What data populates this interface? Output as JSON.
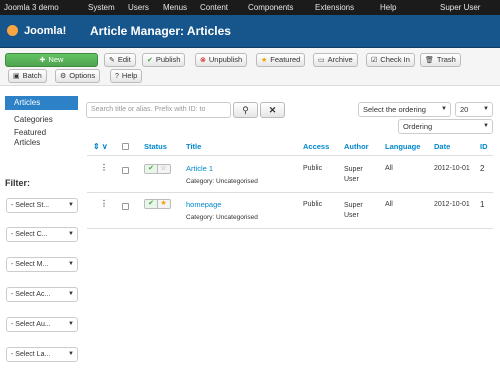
{
  "topbar": {
    "site": "Joomla 3 demo",
    "menus": [
      "System",
      "Users",
      "Menus",
      "Content",
      "Components",
      "Extensions",
      "Help"
    ],
    "user": "Super User"
  },
  "header": {
    "logo": "Joomla!",
    "title": "Article Manager: Articles"
  },
  "toolbar": {
    "new": "New",
    "edit": "Edit",
    "publish": "Publish",
    "unpublish": "Unpublish",
    "featured": "Featured",
    "archive": "Archive",
    "checkin": "Check In",
    "trash": "Trash",
    "batch": "Batch",
    "options": "Options",
    "help": "Help"
  },
  "sidebar": {
    "items": [
      "Articles",
      "Categories",
      "Featured Articles"
    ],
    "filter_heading": "Filter:",
    "filters": [
      "- Select St...",
      "- Select C...",
      "- Select M...",
      "- Select Ac...",
      "- Select Au...",
      "- Select La..."
    ]
  },
  "search": {
    "placeholder": "Search title or alias. Prefix with ID: to"
  },
  "ordering": {
    "select": "Select the ordering",
    "limit": "20",
    "direction": "Ordering"
  },
  "table": {
    "headers": [
      "Status",
      "Title",
      "Access",
      "Author",
      "Language",
      "Date",
      "ID"
    ],
    "rows": [
      {
        "title": "Article 1",
        "category": "Category: Uncategorised",
        "access": "Public",
        "author": "Super User",
        "language": "All",
        "date": "2012-10-01",
        "id": "2",
        "featured": false
      },
      {
        "title": "homepage",
        "category": "Category: Uncategorised",
        "access": "Public",
        "author": "Super User",
        "language": "All",
        "date": "2012-10-01",
        "id": "1",
        "featured": true
      }
    ]
  },
  "colors": {
    "header_bg": "#17568c",
    "topbar_bg": "#1b1b1b",
    "link": "#08c",
    "new_button": "#51a351"
  }
}
